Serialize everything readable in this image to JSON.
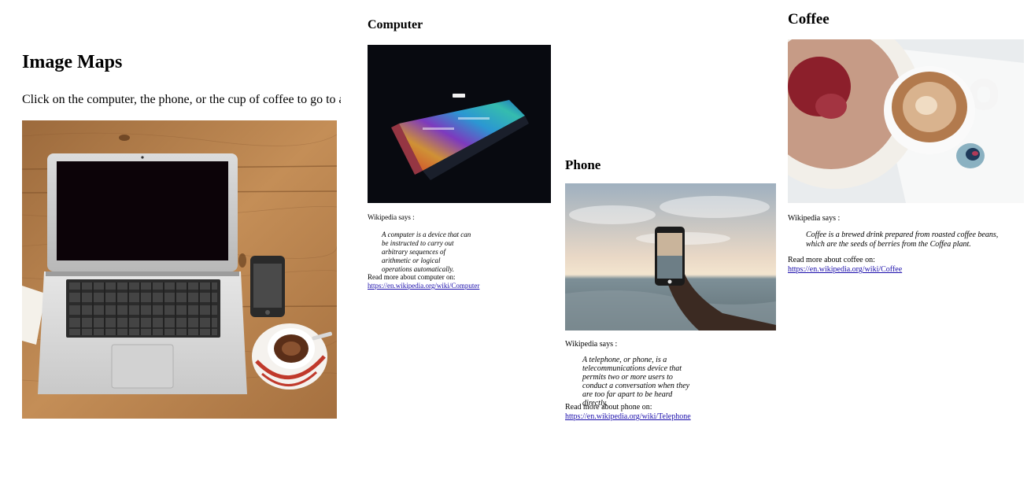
{
  "main": {
    "title": "Image Maps",
    "intro": "Click on the computer, the phone, or the cup of coffee to go to a new page and read more about the topic:",
    "image": {
      "description_icon": "workplace-image"
    }
  },
  "computer": {
    "title": "Computer",
    "says": "Wikipedia says :",
    "quote": "A computer is a device that can be instructed to carry out arbitrary sequences of arithmetic or logical operations automatically.",
    "more_label": "Read more about computer on:",
    "link": "https://en.wikipedia.org/wiki/Computer"
  },
  "phone": {
    "title": "Phone",
    "says": "Wikipedia says :",
    "quote": "A telephone, or phone, is a telecommunications device that permits two or more users to conduct a conversation when they are too far apart to be heard directly.",
    "more_label": "Read more about phone on:",
    "link": "https://en.wikipedia.org/wiki/Telephone"
  },
  "coffee": {
    "title": "Coffee",
    "says": "Wikipedia says :",
    "quote": "Coffee is a brewed drink prepared from roasted coffee beans, which are the seeds of berries from the Coffea plant.",
    "more_label": "Read more about coffee on:",
    "link": "https://en.wikipedia.org/wiki/Coffee"
  },
  "colors": {
    "link": "#1a0dab",
    "wood": "#b07a47"
  }
}
